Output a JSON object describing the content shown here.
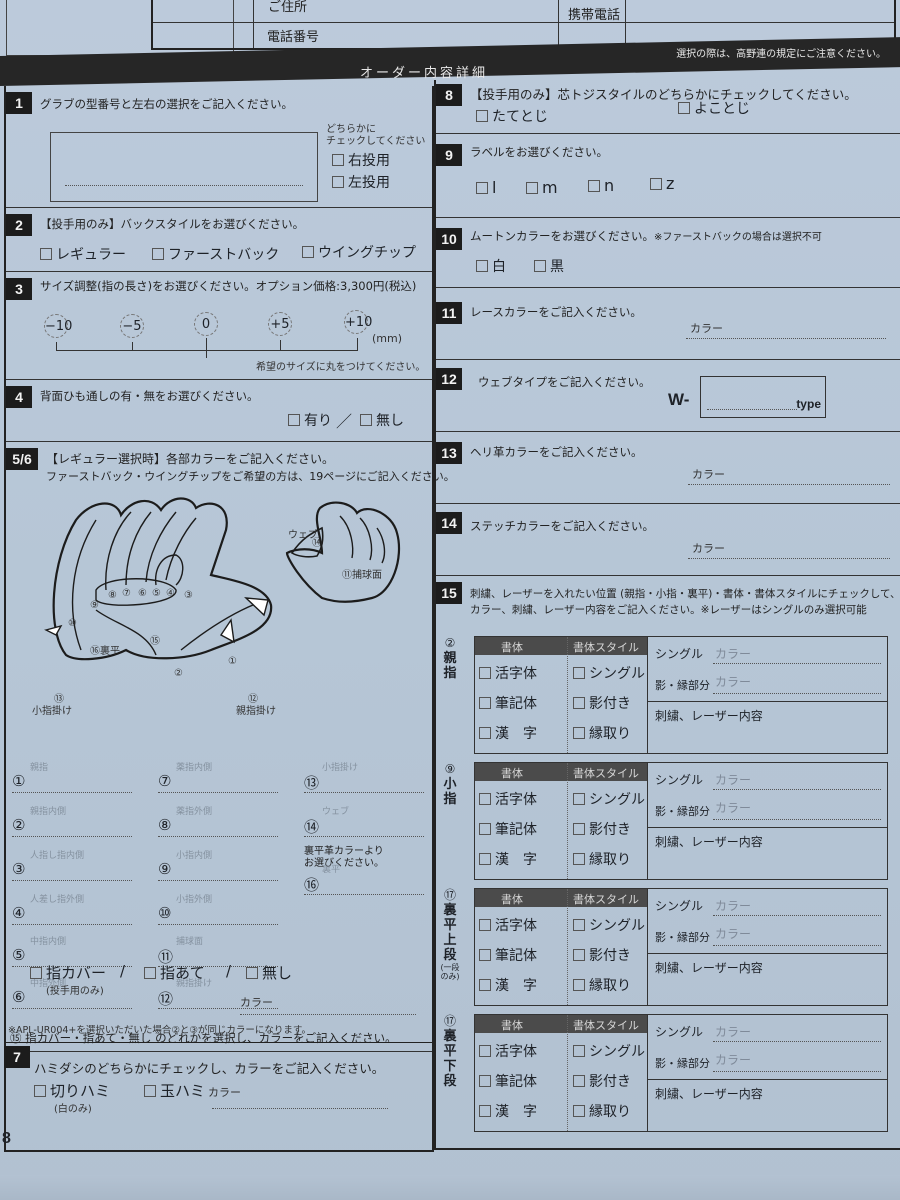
{
  "header": {
    "address_label": "ご住所",
    "phone_label": "電話番号",
    "mobile_label": "携帯電話",
    "section_title": "オーダー内容詳細",
    "note": "選択の際は、高野連の規定にご注意ください。"
  },
  "s1": {
    "num": "1",
    "question": "グラブの型番号と左右の選択をご記入ください。",
    "hint_line1": "どちらかに",
    "hint_line2": "チェックしてください",
    "options": [
      "右投用",
      "左投用"
    ]
  },
  "s2": {
    "num": "2",
    "question": "【投手用のみ】バックスタイルをお選びください。",
    "options": [
      "レギュラー",
      "ファーストバック",
      "ウイングチップ"
    ]
  },
  "s3": {
    "num": "3",
    "question": "サイズ調整(指の長さ)をお選びください。オプション価格:3,300円(税込)",
    "sizes": [
      "−10",
      "−5",
      "0",
      "+5",
      "+10"
    ],
    "unit": "(mm)",
    "note": "希望のサイズに丸をつけてください。"
  },
  "s4": {
    "num": "4",
    "question": "背面ひも通しの有・無をお選びください。",
    "options": [
      "有り",
      "無し"
    ],
    "separator": "／"
  },
  "s56": {
    "num": "5/6",
    "question": "【レギュラー選択時】各部カラーをご記入ください。",
    "sub": "ファーストバック・ウイングチップをご希望の方は、19ページにご記入ください。",
    "diagram_labels": {
      "web": "ウェブ",
      "c14": "⑭",
      "catch": "⑪捕球面",
      "back": "⑯裏平",
      "c15": "⑮",
      "c2": "②",
      "c1": "①",
      "pinky_hook_num": "⑬",
      "pinky_hook": "小指掛け",
      "thumb_hook_num": "⑫",
      "thumb_hook": "親指掛け",
      "fingers": [
        "⑩",
        "⑨",
        "⑧",
        "⑦",
        "⑥",
        "⑤",
        "④",
        "③"
      ]
    },
    "parts": [
      {
        "n": "①",
        "label": "親指"
      },
      {
        "n": "②",
        "label": "親指内側"
      },
      {
        "n": "③",
        "label": "人指し指内側"
      },
      {
        "n": "④",
        "label": "人差し指外側"
      },
      {
        "n": "⑤",
        "label": "中指内側"
      },
      {
        "n": "⑥",
        "label": "中指外側"
      },
      {
        "n": "⑦",
        "label": "薬指内側"
      },
      {
        "n": "⑧",
        "label": "薬指外側"
      },
      {
        "n": "⑨",
        "label": "小指内側"
      },
      {
        "n": "⑩",
        "label": "小指外側"
      },
      {
        "n": "⑪",
        "label": "捕球面"
      },
      {
        "n": "⑫",
        "label": "親指掛け"
      },
      {
        "n": "⑬",
        "label": "小指掛け"
      },
      {
        "n": "⑭",
        "label": "ウェブ"
      },
      {
        "n": "⑯",
        "label": "裏平"
      }
    ],
    "back_note_1": "裏平革カラーより",
    "back_note_2": "お選びください。",
    "finger_q": "⑮ 指カバー・指あて・無し のどれかを選択し、カラーをご記入ください。",
    "finger_options": [
      "指カバー",
      "指あて",
      "無し"
    ],
    "finger_sep": "/",
    "finger_cover_note": "(投手用のみ)",
    "color_label": "カラー",
    "footnote": "※APL-UR004+を選択いただいた場合②と③が同じカラーになります。"
  },
  "s7": {
    "num": "7",
    "question": "ハミダシのどちらかにチェックし、カラーをご記入ください。",
    "options": [
      "切りハミ",
      "玉ハミ"
    ],
    "kiri_note": "(白のみ)",
    "color_label": "カラー"
  },
  "s8": {
    "num": "8",
    "question": "【投手用のみ】芯トジスタイルのどちらかにチェックしてください。",
    "options": [
      "たてとじ",
      "よことじ"
    ]
  },
  "s9": {
    "num": "9",
    "question": "ラベルをお選びください。",
    "options": [
      "l",
      "m",
      "n",
      "z"
    ]
  },
  "s10": {
    "num": "10",
    "question": "ムートンカラーをお選びください。",
    "note": "※ファーストバックの場合は選択不可",
    "options": [
      "白",
      "黒"
    ]
  },
  "s11": {
    "num": "11",
    "question": "レースカラーをご記入ください。",
    "color_label": "カラー"
  },
  "s12": {
    "num": "12",
    "question": "ウェブタイプをご記入ください。",
    "prefix": "W-",
    "suffix": "type"
  },
  "s13": {
    "num": "13",
    "question": "ヘリ革カラーをご記入ください。",
    "color_label": "カラー"
  },
  "s14": {
    "num": "14",
    "question": "ステッチカラーをご記入ください。",
    "color_label": "カラー"
  },
  "s15": {
    "num": "15",
    "question_1": "刺繍、レーザーを入れたい位置 (親指・小指・裏平)・書体・書体スタイルにチェックして、",
    "question_2": "カラー、刺繍、レーザー内容をご記入ください。※レーザーはシングルのみ選択可能",
    "head_font": "書体",
    "head_style": "書体スタイル",
    "fonts": [
      "活字体",
      "筆記体",
      "漢　字"
    ],
    "styles": [
      "シングル",
      "影付き",
      "縁取り"
    ],
    "single_label": "シングル",
    "shadow_label": "影・縁部分",
    "color_label": "カラー",
    "content_label": "刺繍、レーザー内容",
    "positions": [
      {
        "num": "②",
        "label": [
          "親",
          "指"
        ],
        "note": ""
      },
      {
        "num": "⑨",
        "label": [
          "小",
          "指"
        ],
        "note": ""
      },
      {
        "num": "⑰",
        "label": [
          "裏",
          "平",
          "上",
          "段"
        ],
        "note": "(一段のみ)"
      },
      {
        "num": "⑰",
        "label": [
          "裏",
          "平",
          "下",
          "段"
        ],
        "note": ""
      }
    ]
  },
  "page_number": "8"
}
